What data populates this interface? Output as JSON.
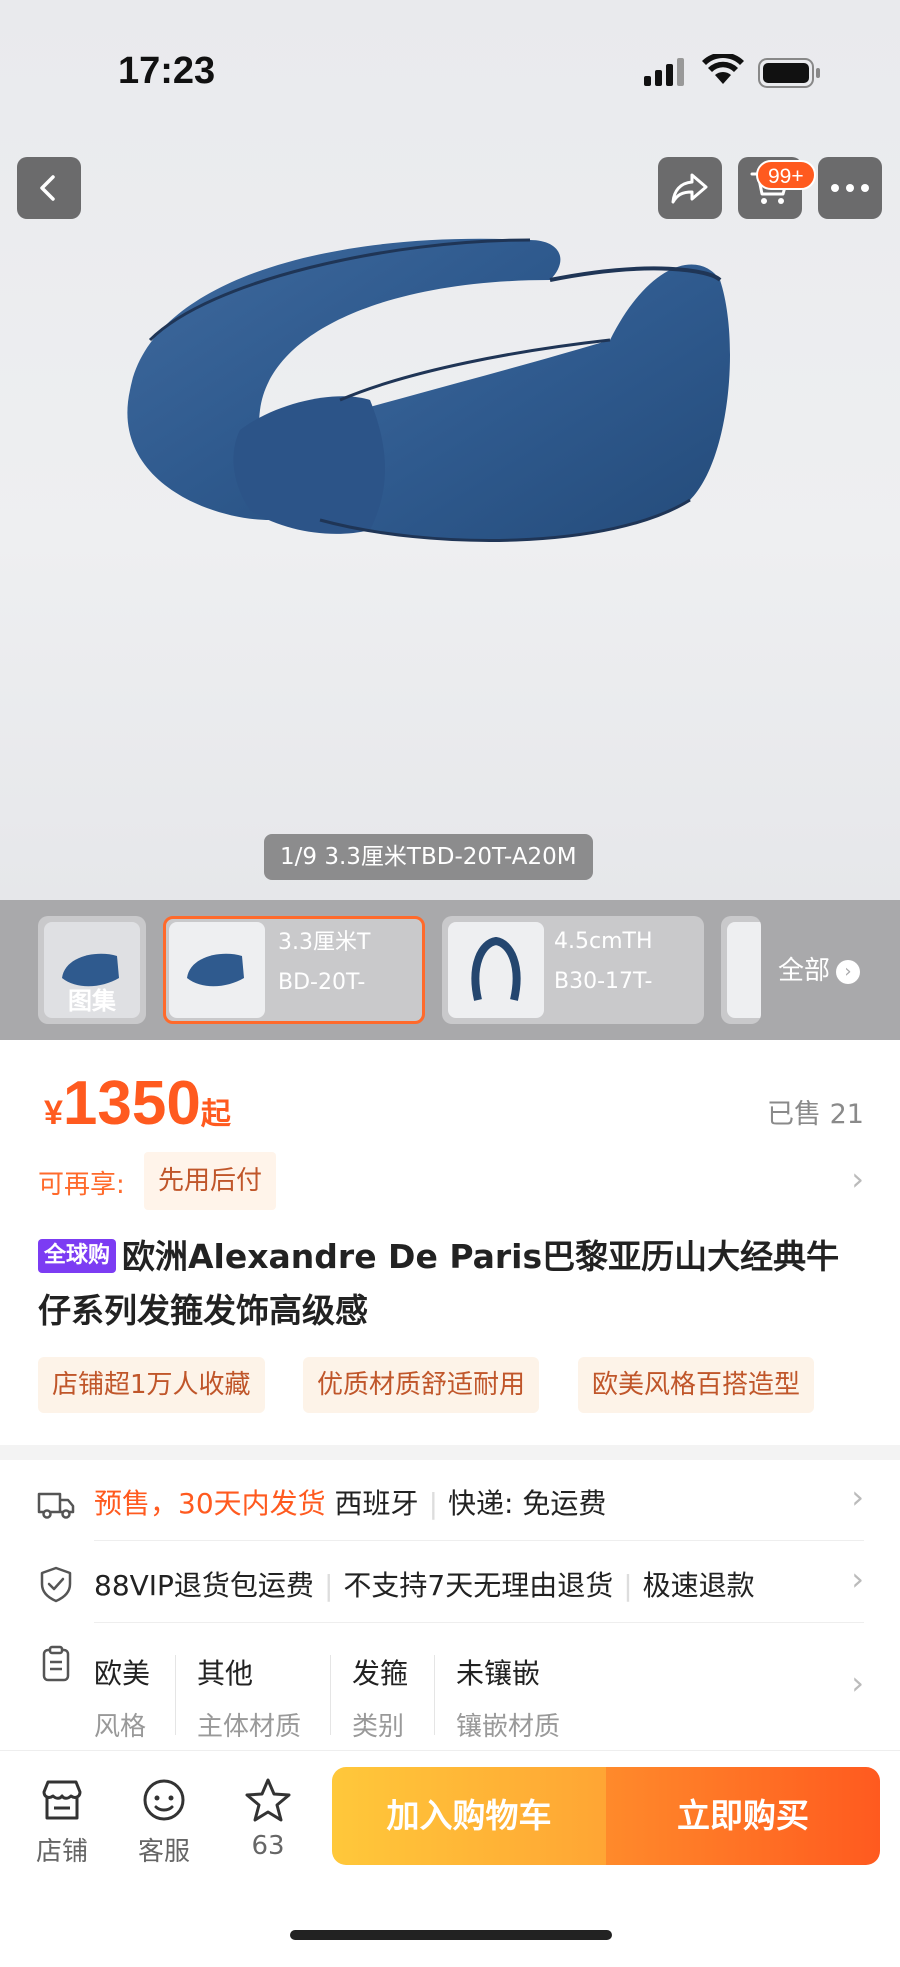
{
  "status_bar": {
    "time": "17:23"
  },
  "top_nav": {
    "cart_badge": "99+"
  },
  "image": {
    "caption": "1/9 3.3厘米TBD-20T-A20M"
  },
  "thumbnails": {
    "gallery_label": "图集",
    "items": [
      {
        "line1": "3.3厘米T",
        "line2": "BD-20T-"
      },
      {
        "line1": "4.5cmTH",
        "line2": "B30-17T-"
      }
    ],
    "all_label": "全部"
  },
  "product": {
    "currency": "¥",
    "price": "1350",
    "price_suffix": "起",
    "sold": "已售 21",
    "enjoy_label": "可再享:",
    "enjoy_tag": "先用后付",
    "global_tag": "全球购",
    "title": "欧洲Alexandre De Paris巴黎亚历山大经典牛仔系列发箍发饰高级感",
    "tags": [
      "店铺超1万人收藏",
      "优质材质舒适耐用",
      "欧美风格百搭造型"
    ]
  },
  "service": {
    "shipping_presale": "预售，30天内发货",
    "shipping_origin": "西班牙",
    "shipping_express": "快递: 免运费",
    "guarantee_1": "88VIP退货包运费",
    "guarantee_2": "不支持7天无理由退货",
    "guarantee_3": "极速退款",
    "attributes": [
      {
        "value": "欧美",
        "key": "风格"
      },
      {
        "value": "其他",
        "key": "主体材质"
      },
      {
        "value": "发箍",
        "key": "类别"
      },
      {
        "value": "未镶嵌",
        "key": "镶嵌材质"
      }
    ]
  },
  "bottom_bar": {
    "store_label": "店铺",
    "service_label": "客服",
    "favorites_count": "63",
    "add_to_cart": "加入购物车",
    "buy_now": "立即购买"
  },
  "colors": {
    "accent": "#ff5a1f",
    "tag_bg": "#fdf3e8",
    "global_tag": "#7c3cf3",
    "cart_gradient_start": "#ffc83a",
    "buy_gradient_start": "#ff8a2b"
  },
  "icons": [
    "back-icon",
    "share-icon",
    "cart-icon",
    "more-icon",
    "truck-icon",
    "shield-icon",
    "clipboard-icon",
    "store-icon",
    "service-face-icon",
    "star-icon"
  ]
}
